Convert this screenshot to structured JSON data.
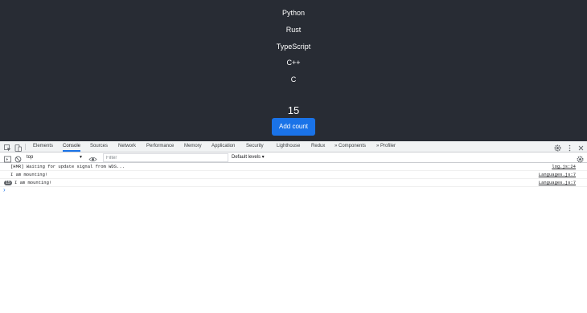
{
  "app": {
    "languages": [
      "Python",
      "Rust",
      "TypeScript",
      "C++",
      "C"
    ],
    "count": "15",
    "add_button_label": "Add count",
    "button_color": "#1a73e8",
    "background_color": "#282c34"
  },
  "devtools": {
    "icons": [
      "inspect-element-icon",
      "device-toolbar-icon",
      "settings-gear-icon",
      "more-menu-icon",
      "close-icon",
      "sidebar-toggle-icon",
      "clear-console-icon",
      "live-expression-eye-icon",
      "console-settings-icon"
    ],
    "tabs": [
      "Elements",
      "Console",
      "Sources",
      "Network",
      "Performance",
      "Memory",
      "Application",
      "Security",
      "Lighthouse",
      "Redux",
      "» Components",
      "» Profiler"
    ],
    "active_tab": "Console",
    "context": "top",
    "filter_placeholder": "Filter",
    "levels": "Default levels ▾",
    "prompt_symbol": "›",
    "logs": [
      {
        "message": "[HMR] Waiting for update signal from WDS...",
        "source": "log.js:24",
        "count": ""
      },
      {
        "message": "I am mounting!",
        "source": "Languages.js:7",
        "count": ""
      },
      {
        "message": "I am mounting!",
        "source": "Languages.js:7",
        "count": "15"
      }
    ]
  }
}
